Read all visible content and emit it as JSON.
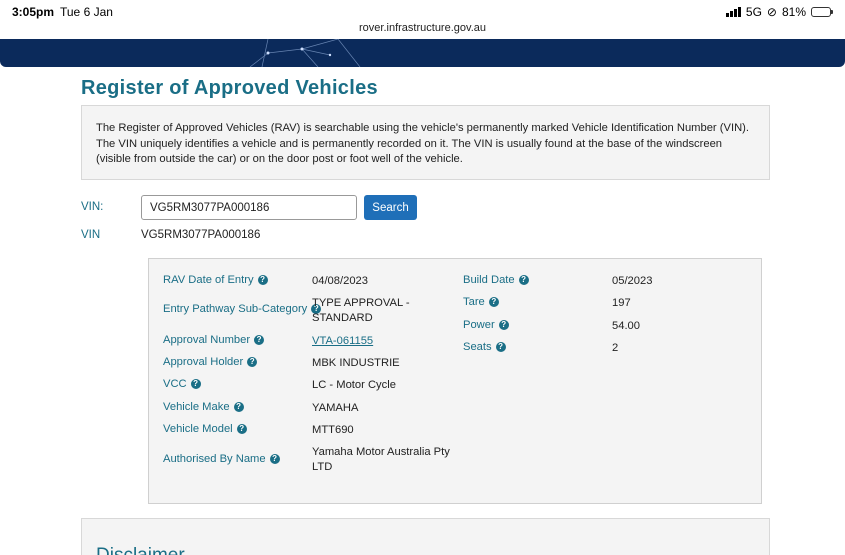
{
  "status": {
    "time": "3:05pm",
    "date": "Tue 6 Jan",
    "network": "5G",
    "battery": "81%",
    "battery_level": 0.81
  },
  "browser": {
    "url": "rover.infrastructure.gov.au"
  },
  "page": {
    "title": "Register of Approved Vehicles",
    "intro": "The Register of Approved Vehicles (RAV) is searchable using the vehicle's permanently marked Vehicle Identification Number (VIN). The VIN uniquely identifies a vehicle and is permanently recorded on it. The VIN is usually found at the base of the windscreen (visible from outside the car) or on the door post or foot well of the vehicle."
  },
  "search": {
    "label": "VIN:",
    "value": "VG5RM3077PA000186",
    "button": "Search"
  },
  "result_vin": {
    "label": "VIN",
    "value": "VG5RM3077PA000186"
  },
  "details": {
    "left": [
      {
        "label": "RAV Date of Entry",
        "value": "04/08/2023"
      },
      {
        "label": "Entry Pathway Sub-Category",
        "value": "TYPE APPROVAL - STANDARD"
      },
      {
        "label": "Approval Number",
        "value": "VTA-061155"
      },
      {
        "label": "Approval Holder",
        "value": "MBK INDUSTRIE"
      },
      {
        "label": "VCC",
        "value": "LC - Motor Cycle"
      },
      {
        "label": "Vehicle Make",
        "value": "YAMAHA"
      },
      {
        "label": "Vehicle Model",
        "value": "MTT690"
      },
      {
        "label": "Authorised By Name",
        "value": "Yamaha Motor Australia Pty LTD"
      }
    ],
    "right": [
      {
        "label": "Build Date",
        "value": "05/2023"
      },
      {
        "label": "Tare",
        "value": "197"
      },
      {
        "label": "Power",
        "value": "54.00"
      },
      {
        "label": "Seats",
        "value": "2"
      }
    ]
  },
  "disclaimer": {
    "title": "Disclaimer"
  }
}
